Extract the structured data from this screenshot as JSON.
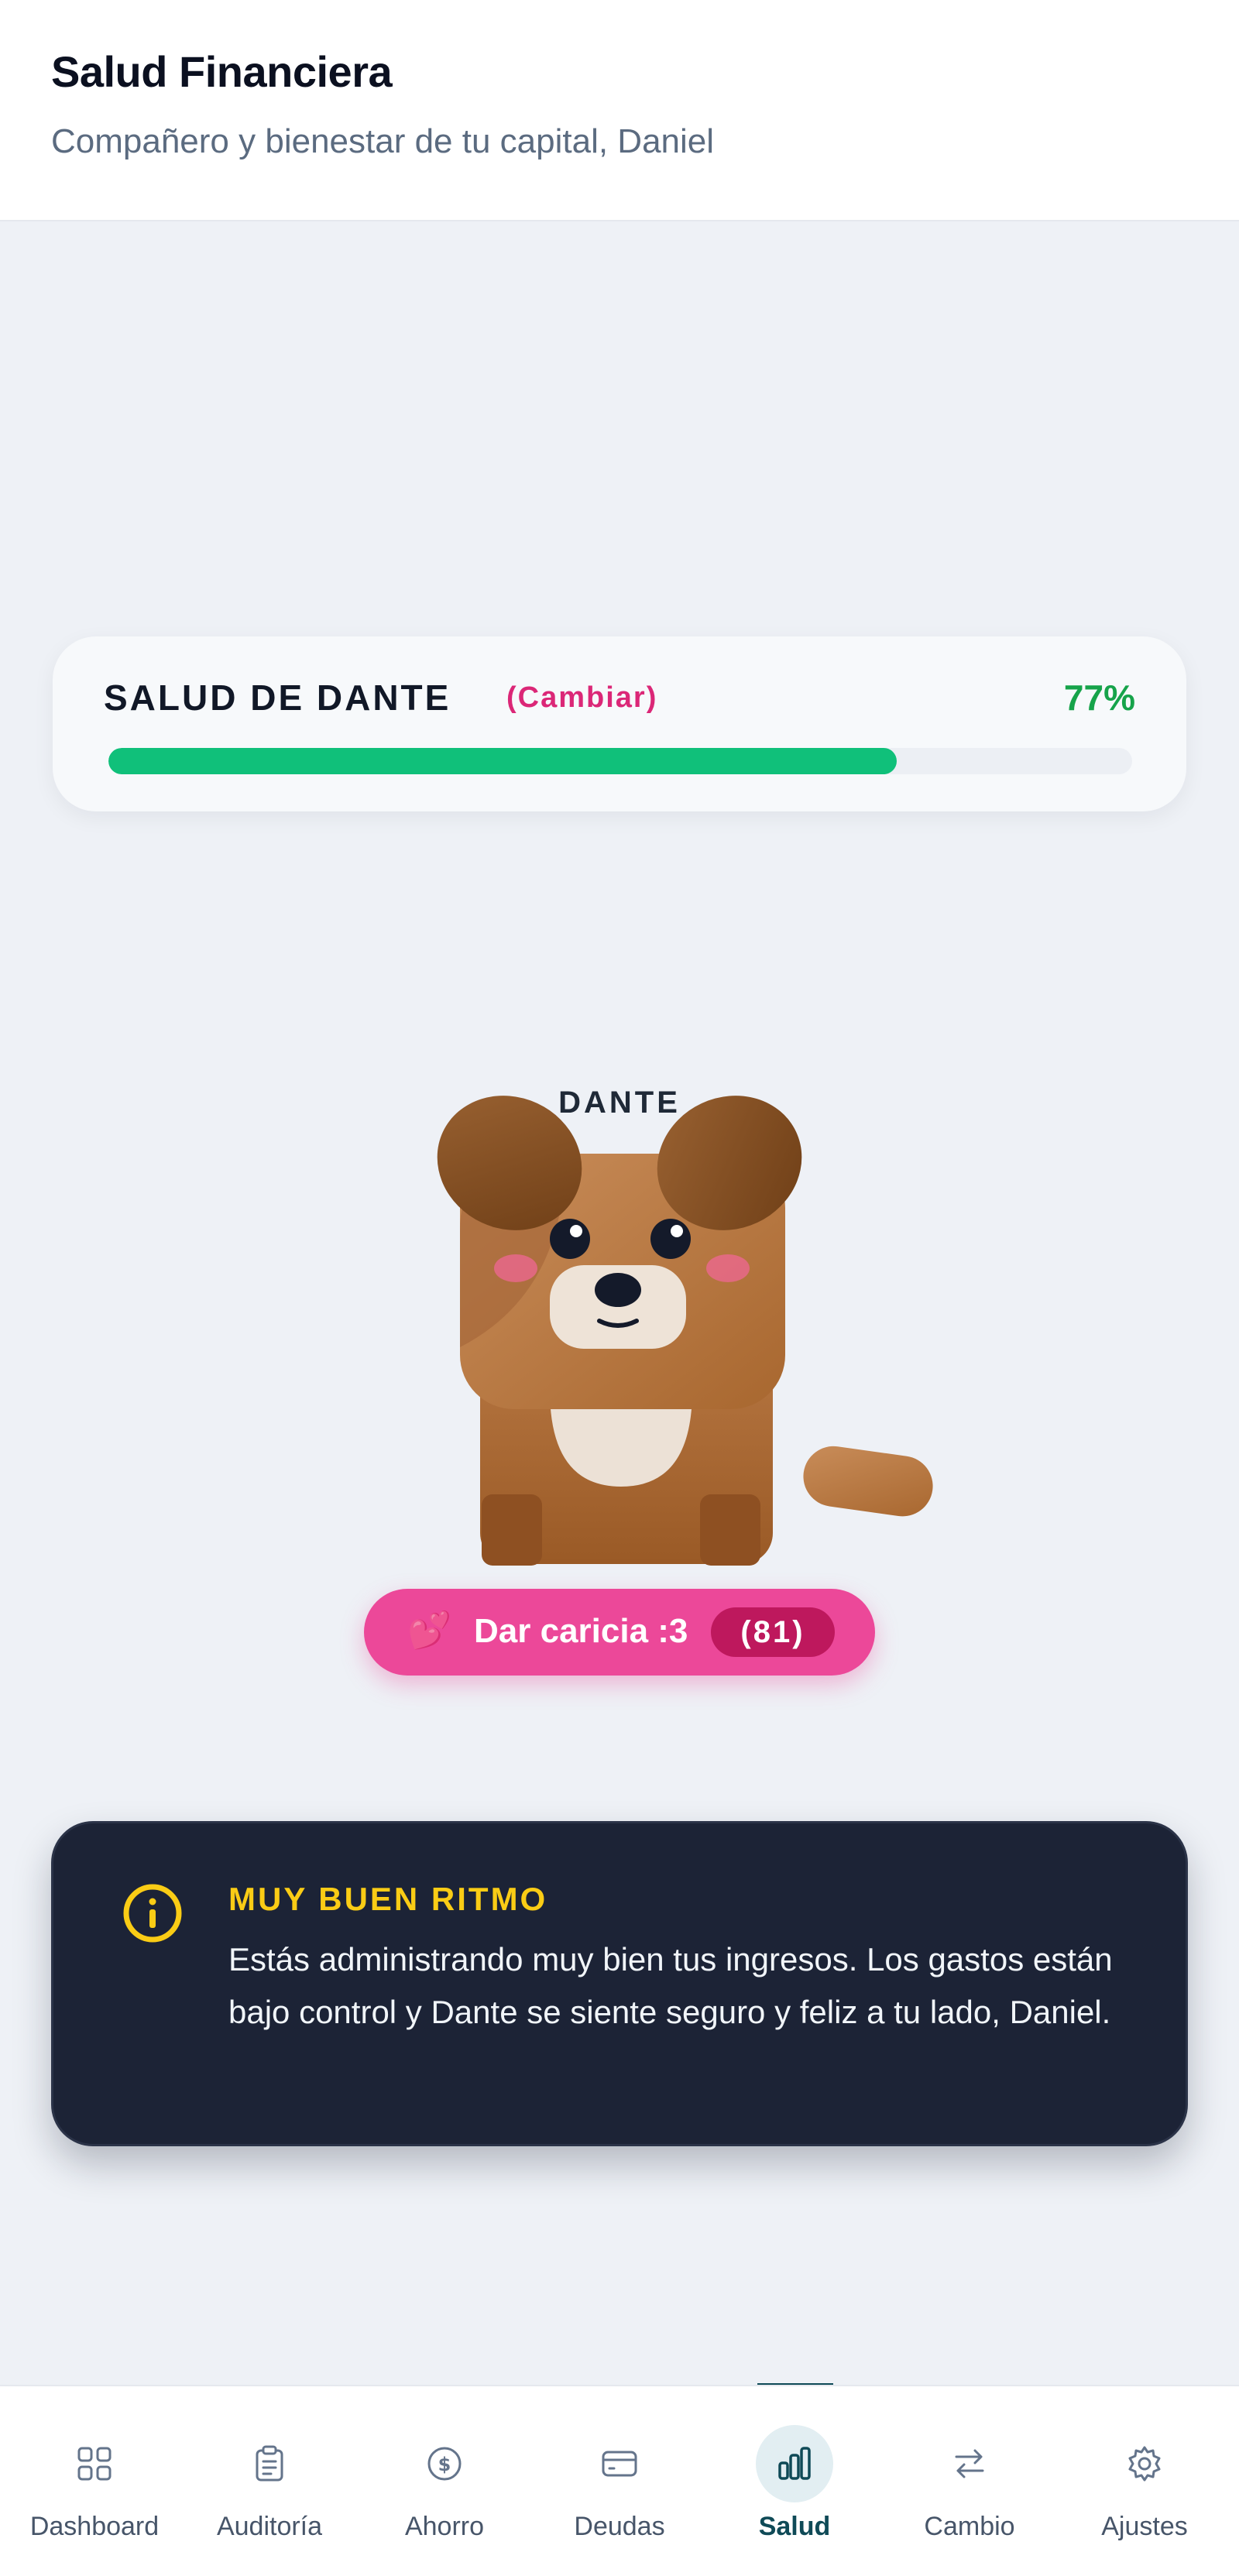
{
  "header": {
    "title": "Salud Financiera",
    "subtitle": "Compañero y bienestar de tu capital, Daniel"
  },
  "health": {
    "label": "SALUD DE DANTE",
    "change_label": "(Cambiar)",
    "percent_label": "77%",
    "percent_value": 0.77,
    "bar_color": "#10c07a"
  },
  "pet": {
    "name": "DANTE",
    "button_label": "Dar caricia :3",
    "button_icon": "hearts-icon",
    "count_label": "(81)"
  },
  "info": {
    "icon": "info-icon",
    "heading": "MUY BUEN RITMO",
    "body": "Estás administrando muy bien tus ingresos. Los gastos están bajo control y Dante se siente seguro y feliz a tu lado, Daniel."
  },
  "nav": {
    "items": [
      {
        "label": "Dashboard",
        "icon": "grid-icon"
      },
      {
        "label": "Auditoría",
        "icon": "clipboard-icon"
      },
      {
        "label": "Ahorro",
        "icon": "dollar-circle-icon"
      },
      {
        "label": "Deudas",
        "icon": "card-icon"
      },
      {
        "label": "Salud",
        "icon": "bar-chart-icon",
        "active": true
      },
      {
        "label": "Cambio",
        "icon": "swap-icon"
      },
      {
        "label": "Ajustes",
        "icon": "gear-icon"
      }
    ]
  },
  "colors": {
    "accent_pink": "#ec4899",
    "accent_green": "#16a34a",
    "dark_card": "#1c2336",
    "warning_yellow": "#facc15",
    "nav_active": "#0f4a57"
  }
}
